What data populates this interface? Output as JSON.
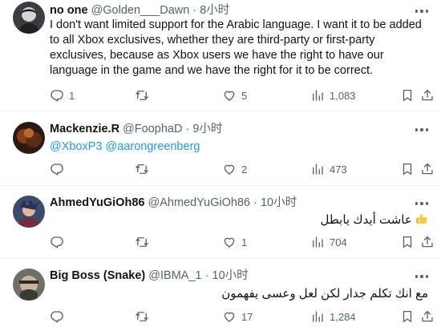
{
  "tweets": [
    {
      "name": "no one",
      "handle": "@Golden___Dawn",
      "sep": "·",
      "time": "8小时",
      "text": "I don't want limited support for the Arabic language. I want it to be added to all Xbox exclusives, whether they are third-party or first-party exclusives, because as Xbox users we have the right to have our language in the game and we have the right for it to be correct.",
      "replies": "1",
      "retweets": "",
      "likes": "5",
      "views": "1,083"
    },
    {
      "name": "Mackenzie.R",
      "handle": "@FoophaD",
      "sep": "·",
      "time": "9小时",
      "mention1": "@XboxP3",
      "mention2": "@aarongreenberg",
      "replies": "",
      "retweets": "",
      "likes": "2",
      "views": "473"
    },
    {
      "name": "AhmedYuGiOh86",
      "handle": "@AhmedYuGiOh86",
      "sep": "·",
      "time": "10小时",
      "text": "عاشت أيدك يابطل",
      "replies": "",
      "retweets": "",
      "likes": "1",
      "views": "704"
    },
    {
      "name": "Big Boss (Snake)",
      "handle": "@IBMA_1",
      "sep": "·",
      "time": "10小时",
      "text": "مع انك تكلم جدار لكن لعل وعسى يفهمون",
      "replies": "",
      "retweets": "",
      "likes": "17",
      "views": "1,284"
    }
  ],
  "icons": {
    "reply": "reply-icon",
    "retweet": "retweet-icon",
    "like": "heart-icon",
    "views": "views-icon",
    "bookmark": "bookmark-icon",
    "share": "share-icon",
    "more": "more-icon",
    "thumbs_up": "thumbs-up-icon"
  },
  "colors": {
    "link": "#1d9bf0",
    "muted": "#536471",
    "text": "#0f1419",
    "divider": "#eff3f4"
  }
}
